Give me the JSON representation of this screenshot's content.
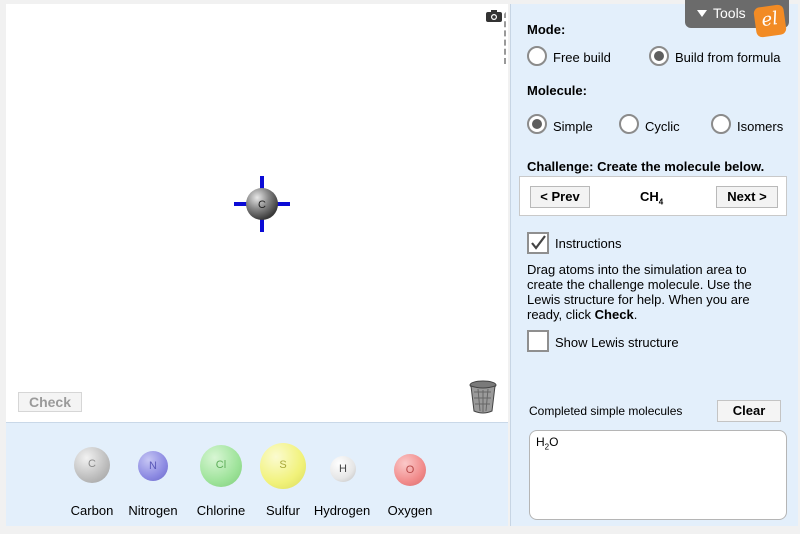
{
  "simulation": {
    "center_atom": {
      "symbol": "C",
      "color": "#777777"
    },
    "check_label": "Check"
  },
  "tray": {
    "atoms": [
      {
        "name": "Carbon",
        "symbol": "C",
        "color": "#c4c4c4"
      },
      {
        "name": "Nitrogen",
        "symbol": "N",
        "color": "#8c8ae2"
      },
      {
        "name": "Chlorine",
        "symbol": "Cl",
        "color": "#9ee39a"
      },
      {
        "name": "Sulfur",
        "symbol": "S",
        "color": "#f1f27a"
      },
      {
        "name": "Hydrogen",
        "symbol": "H",
        "color": "#f2f2f2"
      },
      {
        "name": "Oxygen",
        "symbol": "O",
        "color": "#f18b8b"
      }
    ]
  },
  "panel": {
    "tools_label": "Tools",
    "logo_text": "el",
    "mode": {
      "label": "Mode:",
      "options": [
        {
          "label": "Free build",
          "selected": false
        },
        {
          "label": "Build from formula",
          "selected": true
        }
      ]
    },
    "molecule": {
      "label": "Molecule:",
      "options": [
        {
          "label": "Simple",
          "selected": true
        },
        {
          "label": "Cyclic",
          "selected": false
        },
        {
          "label": "Isomers",
          "selected": false
        }
      ]
    },
    "challenge": {
      "title": "Challenge: Create the molecule below.",
      "prev_label": "< Prev",
      "next_label": "Next >",
      "formula_main": "CH",
      "formula_sub": "4"
    },
    "instructions": {
      "label": "Instructions",
      "checked": true,
      "text_before": "Drag atoms into the simulation area to create the challenge molecule. Use the Lewis structure for help. When you are ready, click ",
      "text_bold": "Check",
      "text_after": "."
    },
    "lewis": {
      "label": "Show Lewis structure",
      "checked": false
    },
    "completed": {
      "label": "Completed simple molecules",
      "clear_label": "Clear",
      "entries": [
        {
          "main1": "H",
          "sub": "2",
          "main2": "O"
        }
      ]
    }
  },
  "colors": {
    "accent_blue": "#0b0bd6",
    "panel_bg": "#e3effb",
    "logo_orange": "#f28b24"
  }
}
